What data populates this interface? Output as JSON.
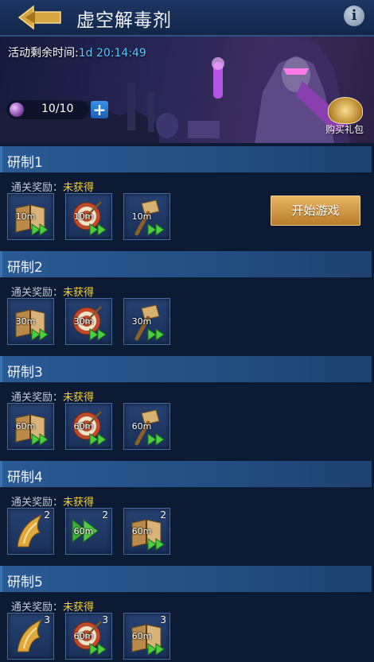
{
  "header": {
    "title": "虚空解毒剂"
  },
  "banner": {
    "timer_label": "活动剩余时间:",
    "timer_value": "1d 20:14:49",
    "stamina": "10/10",
    "plus": "+",
    "gift_label": "购买礼包"
  },
  "sections": [
    {
      "title": "研制1",
      "reward_label": "通关奖励：",
      "reward_status": "未获得",
      "start_label": "开始游戏",
      "items": [
        {
          "icon": "book-icon",
          "duration": "10m",
          "count": ""
        },
        {
          "icon": "target-icon",
          "duration": "10m",
          "count": ""
        },
        {
          "icon": "hammer-icon",
          "duration": "10m",
          "count": ""
        }
      ]
    },
    {
      "title": "研制2",
      "reward_label": "通关奖励：",
      "reward_status": "未获得",
      "items": [
        {
          "icon": "book-icon",
          "duration": "30m",
          "count": ""
        },
        {
          "icon": "target-icon",
          "duration": "30m",
          "count": ""
        },
        {
          "icon": "hammer-icon",
          "duration": "30m",
          "count": ""
        }
      ]
    },
    {
      "title": "研制3",
      "reward_label": "通关奖励：",
      "reward_status": "未获得",
      "items": [
        {
          "icon": "book-icon",
          "duration": "60m",
          "count": ""
        },
        {
          "icon": "target-icon",
          "duration": "60m",
          "count": ""
        },
        {
          "icon": "hammer-icon",
          "duration": "60m",
          "count": ""
        }
      ]
    },
    {
      "title": "研制4",
      "reward_label": "通关奖励：",
      "reward_status": "未获得",
      "items": [
        {
          "icon": "wing-icon",
          "duration": "",
          "count": "2"
        },
        {
          "icon": "speed-arrow-icon",
          "duration": "60m",
          "count": "2"
        },
        {
          "icon": "book-icon",
          "duration": "60m",
          "count": "2"
        }
      ]
    },
    {
      "title": "研制5",
      "reward_label": "通关奖励：",
      "reward_status": "未获得",
      "items": [
        {
          "icon": "wing-icon",
          "duration": "",
          "count": "3"
        },
        {
          "icon": "target-icon",
          "duration": "60m",
          "count": "3"
        },
        {
          "icon": "book-icon",
          "duration": "60m",
          "count": "3"
        }
      ]
    }
  ]
}
